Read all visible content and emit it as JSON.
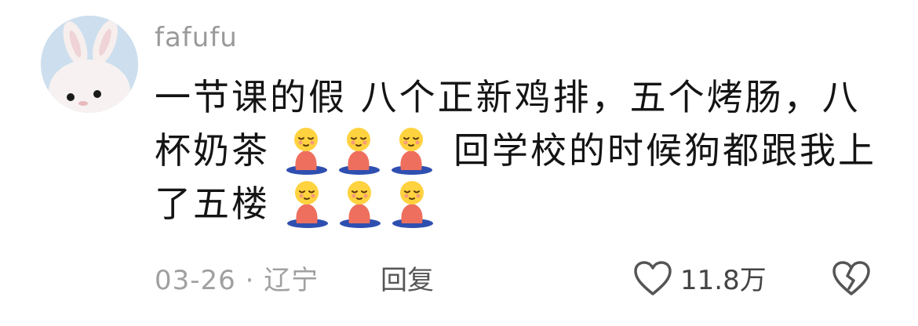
{
  "comment": {
    "username": "fafufu",
    "lines": [
      {
        "before": "一节课的假 八个正新鸡排，五个烤肠，八",
        "emoji_count": 0,
        "after": ""
      },
      {
        "before": "杯奶茶",
        "emoji_count": 3,
        "after": "回学校的时候狗都跟我上"
      },
      {
        "before": "了五楼",
        "emoji_count": 3,
        "after": ""
      }
    ],
    "emoji_icon": "kneeling-pleading-emoji",
    "date": "03-26",
    "separator": "·",
    "location": "辽宁",
    "reply_label": "回复",
    "like_count": "11.8万",
    "like_icon": "heart-outline-icon",
    "dislike_icon": "broken-heart-icon"
  }
}
